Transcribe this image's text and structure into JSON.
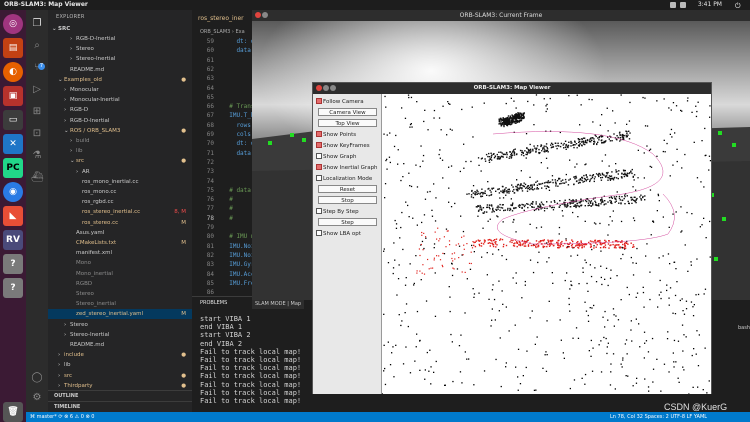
{
  "topbar": {
    "title": "ORB-SLAM3: Map Viewer",
    "clock": "3:41 PM"
  },
  "colors": {
    "dock": "#3b1a34",
    "accent": "#007acc",
    "red": "#e0211c",
    "green": "#22dd22"
  },
  "explorer": {
    "heading": "EXPLORER",
    "root": "SRC",
    "rows": [
      {
        "label": "RGB-D-Inertial",
        "indent": 2,
        "chev": "›",
        "color": "#cccccc",
        "status": ""
      },
      {
        "label": "Stereo",
        "indent": 2,
        "chev": "›",
        "color": "#cccccc",
        "status": ""
      },
      {
        "label": "Stereo-Inertial",
        "indent": 2,
        "chev": "›",
        "color": "#cccccc",
        "status": ""
      },
      {
        "label": "README.md",
        "indent": 1,
        "chev": "",
        "color": "#cccccc",
        "status": ""
      },
      {
        "label": "Examples_old",
        "indent": 0,
        "chev": "⌄",
        "color": "#e2c08d",
        "status": "●"
      },
      {
        "label": "Monocular",
        "indent": 1,
        "chev": "›",
        "color": "#cccccc",
        "status": ""
      },
      {
        "label": "Monocular-Inertial",
        "indent": 1,
        "chev": "›",
        "color": "#cccccc",
        "status": ""
      },
      {
        "label": "RGB-D",
        "indent": 1,
        "chev": "›",
        "color": "#cccccc",
        "status": ""
      },
      {
        "label": "RGB-D-Inertial",
        "indent": 1,
        "chev": "›",
        "color": "#cccccc",
        "status": ""
      },
      {
        "label": "ROS / ORB_SLAM3",
        "indent": 1,
        "chev": "⌄",
        "color": "#e2c08d",
        "status": "●"
      },
      {
        "label": "build",
        "indent": 2,
        "chev": "›",
        "color": "#8c8c8c",
        "status": ""
      },
      {
        "label": "lib",
        "indent": 2,
        "chev": "›",
        "color": "#8c8c8c",
        "status": ""
      },
      {
        "label": "src",
        "indent": 2,
        "chev": "⌄",
        "color": "#e2c08d",
        "status": "●"
      },
      {
        "label": "AR",
        "indent": 3,
        "chev": "›",
        "color": "#cccccc",
        "status": ""
      },
      {
        "label": "ros_mono_inertial.cc",
        "indent": 3,
        "chev": "",
        "color": "#cccccc",
        "status": ""
      },
      {
        "label": "ros_mono.cc",
        "indent": 3,
        "chev": "",
        "color": "#cccccc",
        "status": ""
      },
      {
        "label": "ros_rgbd.cc",
        "indent": 3,
        "chev": "",
        "color": "#cccccc",
        "status": ""
      },
      {
        "label": "ros_stereo_inertial.cc",
        "indent": 3,
        "chev": "",
        "color": "#e2c08d",
        "status": "8, M"
      },
      {
        "label": "ros_stereo.cc",
        "indent": 3,
        "chev": "",
        "color": "#e2c08d",
        "status": "M"
      },
      {
        "label": "Asus.yaml",
        "indent": 2,
        "chev": "",
        "color": "#cccccc",
        "status": ""
      },
      {
        "label": "CMakeLists.txt",
        "indent": 2,
        "chev": "",
        "color": "#e2c08d",
        "status": "M"
      },
      {
        "label": "manifest.xml",
        "indent": 2,
        "chev": "",
        "color": "#cccccc",
        "status": ""
      },
      {
        "label": "Mono",
        "indent": 2,
        "chev": "",
        "color": "#8c8c8c",
        "status": ""
      },
      {
        "label": "Mono_inertial",
        "indent": 2,
        "chev": "",
        "color": "#8c8c8c",
        "status": ""
      },
      {
        "label": "RGBD",
        "indent": 2,
        "chev": "",
        "color": "#8c8c8c",
        "status": ""
      },
      {
        "label": "Stereo",
        "indent": 2,
        "chev": "",
        "color": "#8c8c8c",
        "status": ""
      },
      {
        "label": "Stereo_inertial",
        "indent": 2,
        "chev": "",
        "color": "#8c8c8c",
        "status": ""
      },
      {
        "label": "zed_stereo_inertial.yaml",
        "indent": 2,
        "chev": "",
        "color": "#e2c08d",
        "status": "M"
      },
      {
        "label": "Stereo",
        "indent": 1,
        "chev": "›",
        "color": "#cccccc",
        "status": ""
      },
      {
        "label": "Stereo-Inertial",
        "indent": 1,
        "chev": "›",
        "color": "#cccccc",
        "status": ""
      },
      {
        "label": "README.md",
        "indent": 1,
        "chev": "",
        "color": "#cccccc",
        "status": ""
      },
      {
        "label": "include",
        "indent": 0,
        "chev": "›",
        "color": "#e2c08d",
        "status": "●"
      },
      {
        "label": "lib",
        "indent": 0,
        "chev": "›",
        "color": "#cccccc",
        "status": ""
      },
      {
        "label": "src",
        "indent": 0,
        "chev": "›",
        "color": "#e2c08d",
        "status": "●"
      },
      {
        "label": "Thirdparty",
        "indent": 0,
        "chev": "›",
        "color": "#e2c08d",
        "status": "●"
      }
    ],
    "outline": "OUTLINE",
    "timeline": "TIMELINE"
  },
  "editor": {
    "tab1": "ros_stereo_iner",
    "tab2": "ros_stereo_inertial.cc",
    "breadcrumb": "ORB_SLAM3 › Exa",
    "lines": [
      {
        "n": "59",
        "text": "    dt: d"
      },
      {
        "n": "60",
        "text": "    data:"
      },
      {
        "n": "61",
        "text": ""
      },
      {
        "n": "62",
        "text": ""
      },
      {
        "n": "63",
        "text": ""
      },
      {
        "n": "64",
        "text": ""
      },
      {
        "n": "65",
        "text": ""
      },
      {
        "n": "66",
        "text": "  # Transf"
      },
      {
        "n": "67",
        "text": "  IMU.T_b_"
      },
      {
        "n": "68",
        "text": "    rows:"
      },
      {
        "n": "69",
        "text": "    cols:"
      },
      {
        "n": "70",
        "text": "    dt: d"
      },
      {
        "n": "71",
        "text": "    data:"
      },
      {
        "n": "72",
        "text": ""
      },
      {
        "n": "73",
        "text": ""
      },
      {
        "n": "74",
        "text": ""
      },
      {
        "n": "75",
        "text": "  # data"
      },
      {
        "n": "76",
        "text": "  #"
      },
      {
        "n": "77",
        "text": "  #"
      },
      {
        "n": "78",
        "text": "  #"
      },
      {
        "n": "79",
        "text": ""
      },
      {
        "n": "80",
        "text": "  # IMU n"
      },
      {
        "n": "81",
        "text": "  IMU.Noi"
      },
      {
        "n": "82",
        "text": "  IMU.Noi"
      },
      {
        "n": "83",
        "text": "  IMU.Gyr"
      },
      {
        "n": "84",
        "text": "  IMU.Acc"
      },
      {
        "n": "85",
        "text": "  IMU.Fre"
      },
      {
        "n": "86",
        "text": ""
      }
    ]
  },
  "panel": {
    "tab": "PROBLEMS",
    "term_tab": "SLAM MODE |  Map",
    "shell": "bash",
    "lines": [
      "start VIBA 1",
      "end VIBA 1",
      "start VIBA 2",
      "end VIBA 2",
      "Fail to track local map!",
      "Fail to track local map!",
      "Fail to track local map!",
      "Fail to track local map!",
      "Fail to track local map!",
      "Fail to track local map!",
      "Fail to track local map!"
    ]
  },
  "statusbar": {
    "branch": "master*",
    "sync": "⟳",
    "problems": "⊗ 6 ⚠ 0",
    "warn": "⊗ 0",
    "right": "Ln 78, Col 32   Spaces: 2   UTF-8   LF   YAML"
  },
  "frame_window": {
    "title": "ORB-SLAM3: Current Frame"
  },
  "map_window": {
    "title": "ORB-SLAM3: Map Viewer",
    "checks": [
      {
        "label": "Follow Camera",
        "on": true
      },
      {
        "label": "Show Points",
        "on": true
      },
      {
        "label": "Show KeyFrames",
        "on": true
      },
      {
        "label": "Show Graph",
        "on": false
      },
      {
        "label": "Show Inertial Graph",
        "on": true
      },
      {
        "label": "Localization Mode",
        "on": false
      },
      {
        "label": "Step By Step",
        "on": false
      },
      {
        "label": "Show LBA opt",
        "on": false
      }
    ],
    "buttons": [
      "Camera View",
      "Top View",
      "Reset",
      "Stop",
      "Step"
    ]
  },
  "watermark": "CSDN @KuerG"
}
